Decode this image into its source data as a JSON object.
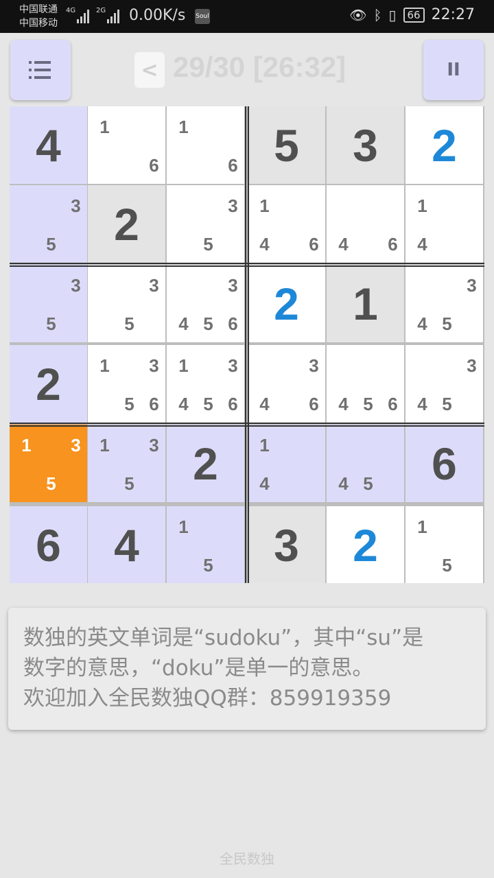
{
  "status_bar": {
    "carrier1": "中国联通",
    "carrier2": "中国移动",
    "net1": "4G",
    "net2": "2G",
    "speed": "0.00K/s",
    "app_icon": "Soul",
    "battery": "66",
    "time": "22:27"
  },
  "header": {
    "prev_label": "<",
    "title": "29/30 [26:32]",
    "menu_icon": "list-icon",
    "pause_label": "II"
  },
  "colors": {
    "highlight": "#dcdcfa",
    "fixed": "#e4e4e4",
    "selected": "#f7931e",
    "user_digit": "#1e88d8"
  },
  "board": {
    "rows": [
      [
        {
          "value": "4",
          "type": "given",
          "bg": "hl"
        },
        {
          "notes": [
            "1",
            "6"
          ],
          "bg": "white"
        },
        {
          "notes": [
            "1",
            "6"
          ],
          "bg": "white"
        },
        {
          "value": "5",
          "type": "given",
          "bg": "fixed"
        },
        {
          "value": "3",
          "type": "given",
          "bg": "fixed"
        },
        {
          "value": "2",
          "type": "user",
          "bg": "white"
        }
      ],
      [
        {
          "notes": [
            "3",
            "5"
          ],
          "bg": "hl"
        },
        {
          "value": "2",
          "type": "given",
          "bg": "fixed"
        },
        {
          "notes": [
            "3",
            "5"
          ],
          "bg": "white"
        },
        {
          "notes": [
            "1",
            "4",
            "6"
          ],
          "bg": "white"
        },
        {
          "notes": [
            "4",
            "6"
          ],
          "bg": "white"
        },
        {
          "notes": [
            "1",
            "4"
          ],
          "bg": "white"
        }
      ],
      [
        {
          "notes": [
            "3",
            "5"
          ],
          "bg": "hl"
        },
        {
          "notes": [
            "3",
            "5"
          ],
          "bg": "white"
        },
        {
          "notes": [
            "3",
            "4",
            "5",
            "6"
          ],
          "bg": "white"
        },
        {
          "value": "2",
          "type": "user",
          "bg": "white"
        },
        {
          "value": "1",
          "type": "given",
          "bg": "fixed"
        },
        {
          "notes": [
            "3",
            "4",
            "5"
          ],
          "bg": "white"
        }
      ],
      [
        {
          "value": "2",
          "type": "given",
          "bg": "hl"
        },
        {
          "notes": [
            "1",
            "3",
            "5",
            "6"
          ],
          "bg": "white"
        },
        {
          "notes": [
            "1",
            "3",
            "4",
            "5",
            "6"
          ],
          "bg": "white"
        },
        {
          "notes": [
            "3",
            "4",
            "6"
          ],
          "bg": "white"
        },
        {
          "notes": [
            "4",
            "5",
            "6"
          ],
          "bg": "white"
        },
        {
          "notes": [
            "3",
            "4",
            "5"
          ],
          "bg": "white"
        }
      ],
      [
        {
          "notes": [
            "1",
            "3",
            "5"
          ],
          "bg": "selected"
        },
        {
          "notes": [
            "1",
            "3",
            "5"
          ],
          "bg": "hl"
        },
        {
          "value": "2",
          "type": "given",
          "bg": "hl"
        },
        {
          "notes": [
            "1",
            "4"
          ],
          "bg": "hl"
        },
        {
          "notes": [
            "4",
            "5"
          ],
          "bg": "hl"
        },
        {
          "value": "6",
          "type": "given",
          "bg": "hl"
        }
      ],
      [
        {
          "value": "6",
          "type": "given",
          "bg": "hl"
        },
        {
          "value": "4",
          "type": "given",
          "bg": "hl"
        },
        {
          "notes": [
            "1",
            "5"
          ],
          "bg": "hl"
        },
        {
          "value": "3",
          "type": "given",
          "bg": "fixed"
        },
        {
          "value": "2",
          "type": "user",
          "bg": "white"
        },
        {
          "notes": [
            "1",
            "5"
          ],
          "bg": "white"
        }
      ]
    ]
  },
  "tip": {
    "line1": "数独的英文单词是“sudoku”，其中“su”是",
    "line2": "数字的意思，“doku”是单一的意思。",
    "line3": "欢迎加入全民数独QQ群：859919359"
  },
  "footer": {
    "label": "全民数独"
  }
}
